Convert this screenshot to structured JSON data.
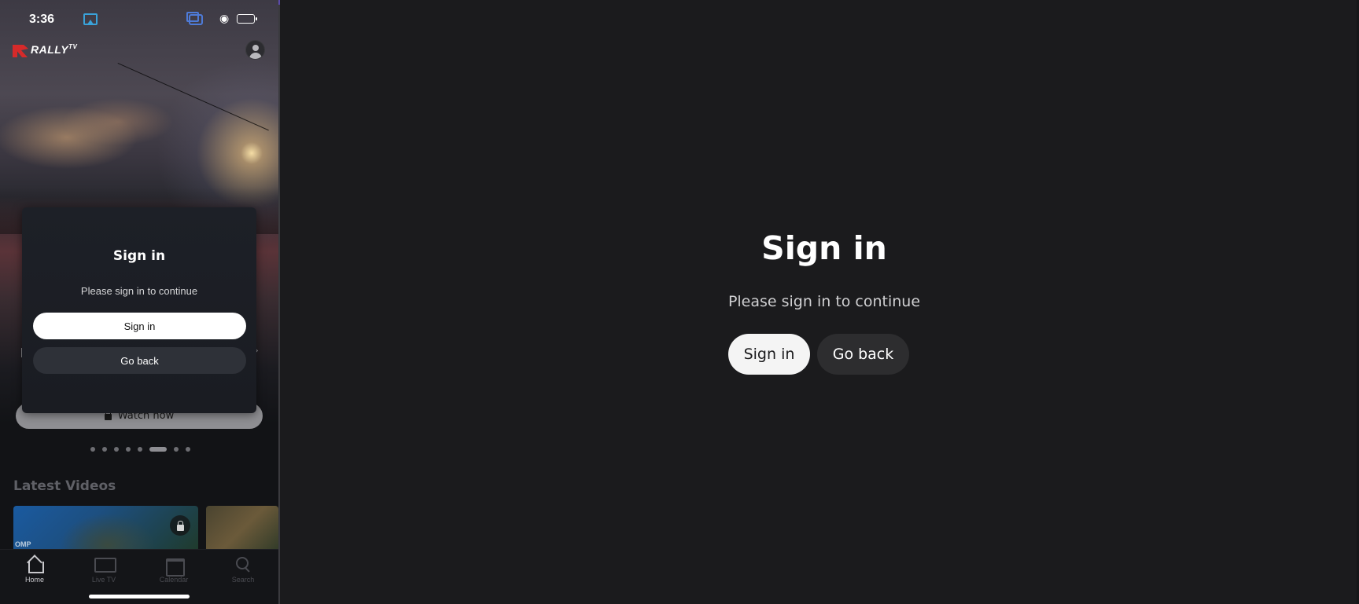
{
  "status_bar": {
    "time": "3:36",
    "icons": [
      "airplay-icon",
      "screen-mirror-icon",
      "wifi-icon",
      "battery-charging-icon"
    ],
    "battery_color": "#30d158"
  },
  "app_header": {
    "logo_text": "RALLY",
    "logo_sub": "TV",
    "logo_color": "#d62a2a",
    "profile_icon": "profile-icon"
  },
  "hero": {
    "watch_now_label": "Watch now",
    "lock_icon": "lock-icon",
    "carousel_dots": 8,
    "active_dot": 6
  },
  "latest_videos": {
    "title": "Latest Videos",
    "thumbnail_logo": "OMP"
  },
  "modal": {
    "title": "Sign in",
    "subtitle": "Please sign in to continue",
    "sign_in_label": "Sign in",
    "go_back_label": "Go back"
  },
  "tab_bar": {
    "tabs": [
      {
        "label": "Home",
        "icon": "home-icon",
        "active": true
      },
      {
        "label": "Live TV",
        "icon": "tv-icon",
        "active": false
      },
      {
        "label": "Calendar",
        "icon": "calendar-icon",
        "active": false
      },
      {
        "label": "Search",
        "icon": "search-icon",
        "active": false
      }
    ]
  },
  "desktop": {
    "title": "Sign in",
    "subtitle": "Please sign in to continue",
    "sign_in_label": "Sign in",
    "go_back_label": "Go back"
  },
  "colors": {
    "background": "#1b1b1d",
    "primary_button": "#f4f4f4",
    "secondary_button": "#2d2d2f"
  }
}
